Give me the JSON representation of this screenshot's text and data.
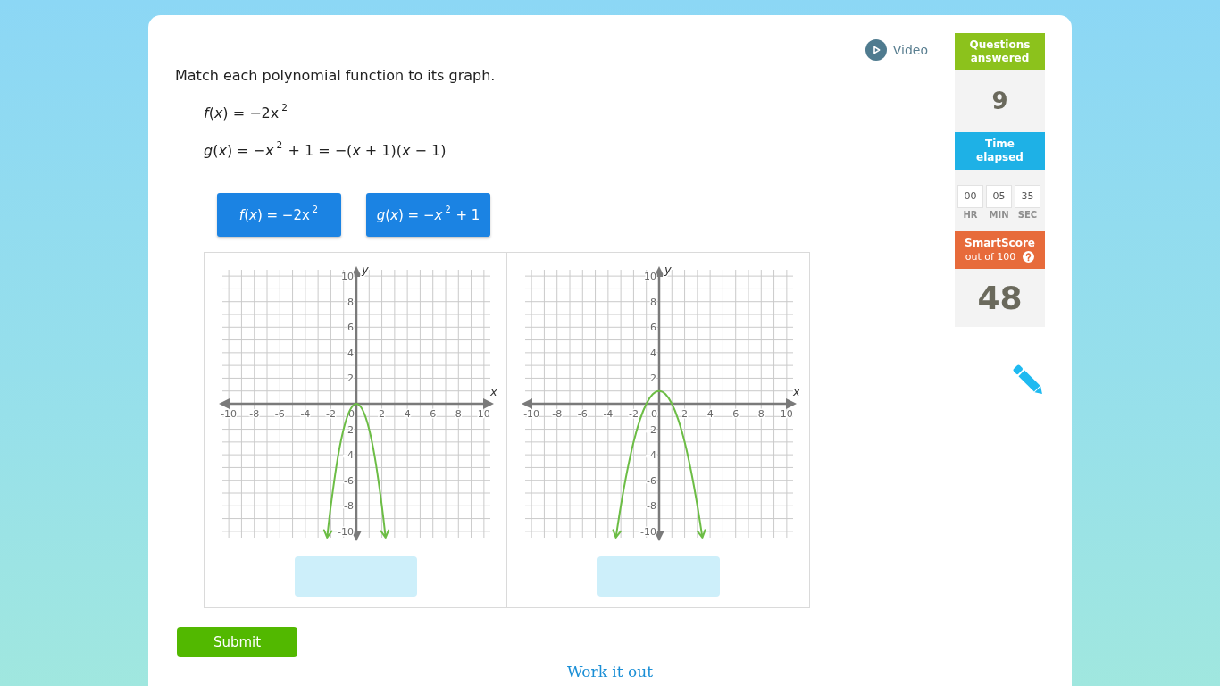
{
  "header": {
    "video_link": "Video"
  },
  "question": {
    "prompt": "Match each polynomial function to its graph.",
    "equations": [
      "*f*(*x*) = −2x$^{2}$",
      "*g*(*x*) = −*x*$^{2}$ + 1 = −(*x* + 1)(*x* − 1)"
    ],
    "answer_tiles": [
      "*f*(*x*) = −2x$^{2}$",
      "*g*(*x*) = −*x*$^{2}$ + 1"
    ],
    "graphs": [
      {
        "chart_data": {
          "type": "line",
          "xlabel": "x",
          "ylabel": "y",
          "x": [
            -2.29,
            -2,
            -1.5,
            -1,
            -0.5,
            0,
            0.5,
            1,
            1.5,
            2,
            2.29
          ],
          "values": [
            -10.49,
            -8,
            -4.5,
            -2,
            -0.5,
            0,
            -0.5,
            -2,
            -4.5,
            -8,
            -10.49
          ],
          "xlim": [
            -10.5,
            10.5
          ],
          "ylim": [
            -10.5,
            10.5
          ],
          "xticks": [
            -10,
            -8,
            -6,
            -4,
            -2,
            0,
            2,
            4,
            6,
            8,
            10
          ],
          "yticks": [
            -10,
            -8,
            -6,
            -4,
            -2,
            2,
            4,
            6,
            8,
            10
          ],
          "grid": true
        }
      },
      {
        "chart_data": {
          "type": "line",
          "xlabel": "x",
          "ylabel": "y",
          "x": [
            -3.39,
            -3,
            -2.5,
            -2,
            -1.5,
            -1,
            -0.5,
            0,
            0.5,
            1,
            1.5,
            2,
            2.5,
            3,
            3.39
          ],
          "values": [
            -10.49,
            -8,
            -5.25,
            -3,
            -1.25,
            0,
            0.75,
            1,
            0.75,
            0,
            -1.25,
            -3,
            -5.25,
            -8,
            -10.49
          ],
          "xlim": [
            -10.5,
            10.5
          ],
          "ylim": [
            -10.5,
            10.5
          ],
          "xticks": [
            -10,
            -8,
            -6,
            -4,
            -2,
            0,
            2,
            4,
            6,
            8,
            10
          ],
          "yticks": [
            -10,
            -8,
            -6,
            -4,
            -2,
            2,
            4,
            6,
            8,
            10
          ],
          "grid": true
        }
      }
    ],
    "submit_button": "Submit"
  },
  "sidebar": {
    "questions_answered": {
      "label": "Questions answered",
      "value": "9"
    },
    "time_elapsed": {
      "label": "Time elapsed",
      "parts": [
        {
          "value": "00",
          "unit": "HR"
        },
        {
          "value": "05",
          "unit": "MIN"
        },
        {
          "value": "35",
          "unit": "SEC"
        }
      ]
    },
    "smartscore": {
      "label": "SmartScore",
      "sublabel": "out of 100",
      "value": "48"
    }
  },
  "footer": {
    "work_it_out": "Work it out"
  }
}
